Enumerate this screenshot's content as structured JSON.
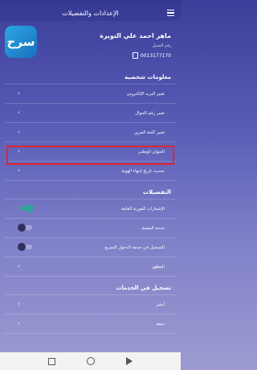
{
  "header": {
    "title": "الإعدادات والتفضيلات"
  },
  "logo": {
    "text": "سرح"
  },
  "profile": {
    "name": "ماهر احمد علي التويرة",
    "customer_label": "رقم العميل",
    "customer_number": "0013177170"
  },
  "personal": {
    "title": "معلومات شخصية",
    "items": [
      {
        "label": "تغيير البريد الإلكتروني"
      },
      {
        "label": "تغيير رقم الجوال"
      },
      {
        "label": "تغيير كلمة المرور"
      },
      {
        "label": "العنوان الوطني"
      },
      {
        "label": "تحديث تاريخ إنتهاء الهوية"
      }
    ]
  },
  "preferences": {
    "title": "التفضيلات",
    "items": [
      {
        "label": "الإشعارات الفورية العامة",
        "toggle": "on"
      },
      {
        "label": "خدمة البصمة",
        "toggle": "off"
      },
      {
        "label": "التسجيل في خدمة الدخول السريع",
        "toggle": "off"
      },
      {
        "label": "المظهر"
      }
    ]
  },
  "services": {
    "title": "تسجيل في الخدمات",
    "items": [
      {
        "label": "أبشر"
      },
      {
        "label": "سمة"
      }
    ]
  },
  "colors": {
    "highlight": "#e0262b",
    "toggle_on": "#2aa39a"
  }
}
